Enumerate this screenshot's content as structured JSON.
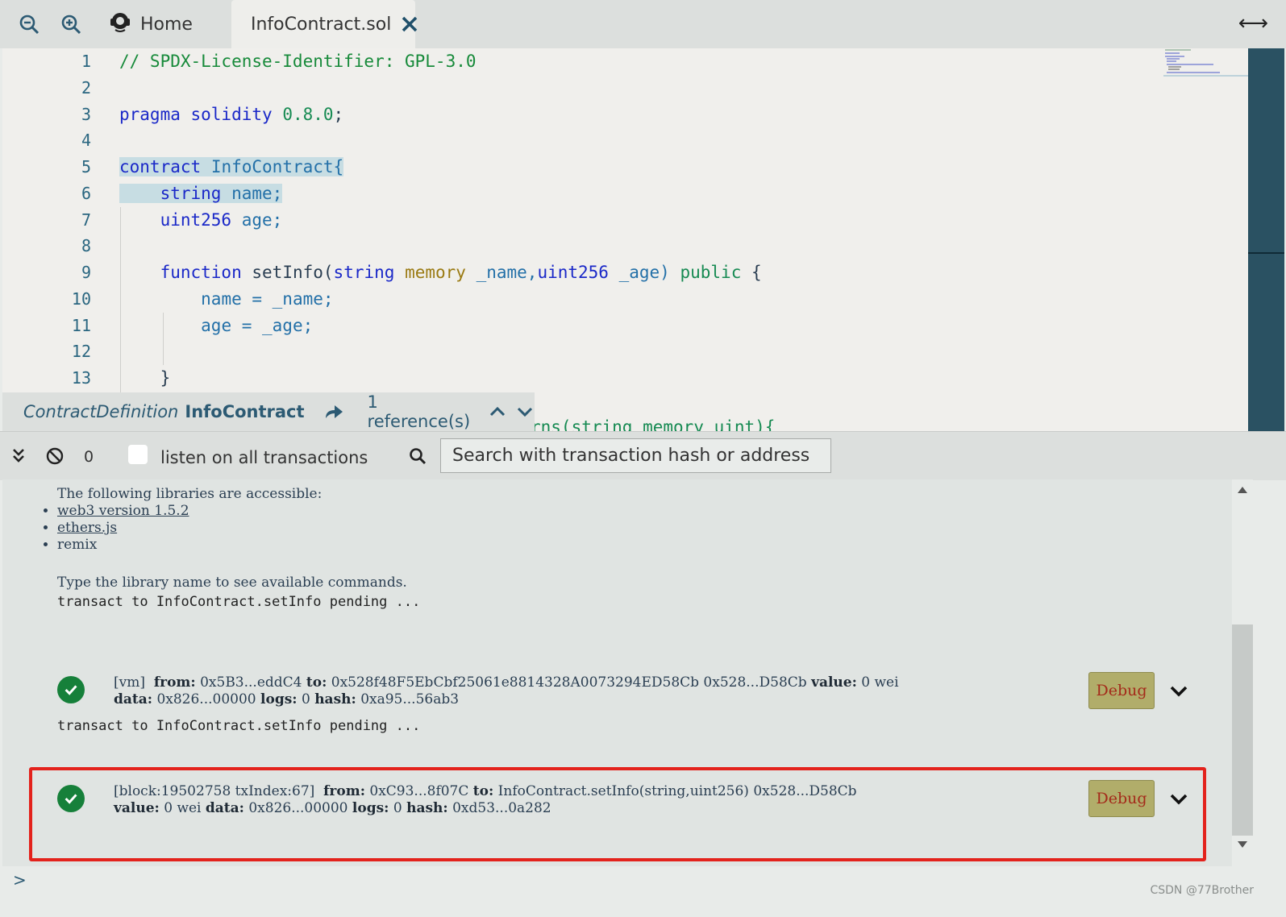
{
  "tabs": {
    "home_label": "Home",
    "active_label": "InfoContract.sol"
  },
  "editor": {
    "lines": [
      {
        "n": "1"
      },
      {
        "n": "2"
      },
      {
        "n": "3"
      },
      {
        "n": "4"
      },
      {
        "n": "5"
      },
      {
        "n": "6"
      },
      {
        "n": "7"
      },
      {
        "n": "8"
      },
      {
        "n": "9"
      },
      {
        "n": "10"
      },
      {
        "n": "11"
      },
      {
        "n": "12"
      },
      {
        "n": "13"
      }
    ],
    "code": {
      "l1": "// SPDX-License-Identifier: GPL-3.0",
      "l3_kw": "pragma solidity",
      "l3_ver": "0.8.0",
      "l3_end": ";",
      "l5_kw": "contract",
      "l5_name": "InfoContract{",
      "l6_kw": "string",
      "l6_rest": "name;",
      "l7_kw": "uint256",
      "l7_rest": "age;",
      "l9_fn": "function",
      "l9_name": "setInfo(",
      "l9_string": "string",
      "l9_memory": "memory",
      "l9_p1": "_name,",
      "l9_uint": "uint256",
      "l9_p2": "_age)",
      "l9_public": "public",
      "l9_brace": "{",
      "l10": "name = _name;",
      "l11": "age = _age;",
      "l13": "}",
      "l15_partial": "rns(string memory uint){"
    }
  },
  "reference_widget": {
    "kind": "ContractDefinition",
    "name": "InfoContract",
    "references": "1 reference(s)"
  },
  "terminal_toolbar": {
    "count": "0",
    "listen_label": "listen on all transactions",
    "search_placeholder": "Search with transaction hash or address"
  },
  "terminal": {
    "intro": "The following libraries are accessible:",
    "libraries": [
      "web3 version 1.5.2",
      "ethers.js",
      "remix"
    ],
    "hint": "Type the library name to see available commands.",
    "pending1": "transact to InfoContract.setInfo pending ...",
    "tx1": {
      "line1_prefix": "[vm]",
      "from_label": "from:",
      "from": "0x5B3...eddC4",
      "to_label": "to:",
      "to": "0x528f48F5EbCbf25061e8814328A0073294ED58Cb 0x528...D58Cb",
      "value_label": "value:",
      "value": "0 wei",
      "data_label": "data:",
      "data": "0x826...00000",
      "logs_label": "logs:",
      "logs": "0",
      "hash_label": "hash:",
      "hash": "0xa95...56ab3"
    },
    "pending2": "transact to InfoContract.setInfo pending ...",
    "tx2": {
      "line1_prefix": "[block:19502758 txIndex:67]",
      "from_label": "from:",
      "from": "0xC93...8f07C",
      "to_label": "to:",
      "to": "InfoContract.setInfo(string,uint256) 0x528...D58Cb",
      "value_label": "value:",
      "value": "0 wei",
      "data_label": "data:",
      "data": "0x826...00000",
      "logs_label": "logs:",
      "logs": "0",
      "hash_label": "hash:",
      "hash": "0xd53...0a282"
    },
    "debug_label": "Debug",
    "prompt": ">"
  },
  "watermark": "CSDN @77Brother",
  "colors": {
    "accent": "#2c5a73",
    "success": "#16803a",
    "debug_bg": "#b1ad6a",
    "highlight_box": "#e3221c"
  }
}
